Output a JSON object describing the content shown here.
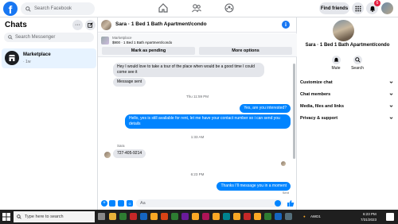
{
  "topbar": {
    "search_placeholder": "Search Facebook",
    "find_friends": "Find friends",
    "notification_count": "6"
  },
  "chats": {
    "title": "Chats",
    "search_placeholder": "Search Messenger",
    "items": [
      {
        "name": "Marketplace",
        "sub": "· 1w"
      }
    ]
  },
  "conversation": {
    "title": "Sara · 1 Bed 1 Bath Apartment/condo",
    "listing": {
      "label": "Marketplace",
      "price": "$900 · 1 Bed 1 Bath Apartment/condo",
      "mark_pending": "Mark as pending",
      "more_options": "More options"
    },
    "messages": [
      {
        "type": "in",
        "text": "Hey I would love to take a tour of the place when would be a good time I could come see it"
      },
      {
        "type": "in",
        "text": "Message sent"
      },
      {
        "type": "time",
        "text": "Thu 11:59 PM"
      },
      {
        "type": "out",
        "text": "Yes, are you interested?"
      },
      {
        "type": "out",
        "text": "Hello, yes is still available for rent, let me have your contact number so i can send you details"
      },
      {
        "type": "time",
        "text": "1:33 AM"
      },
      {
        "type": "sender",
        "text": "Sara"
      },
      {
        "type": "in",
        "text": "727-405-9214"
      },
      {
        "type": "time",
        "text": "6:23 PM"
      },
      {
        "type": "out",
        "text": "Thanks I’ll message you in a moment"
      },
      {
        "type": "status",
        "text": "Sent"
      }
    ],
    "composer_placeholder": "Aa"
  },
  "info_panel": {
    "name": "Sara · 1 Bed 1 Bath Apartment/condo",
    "actions": [
      {
        "label": "Mute"
      },
      {
        "label": "Search"
      }
    ],
    "sections": [
      {
        "label": "Customize chat"
      },
      {
        "label": "Chat members"
      },
      {
        "label": "Media, files and links"
      },
      {
        "label": "Privacy & support"
      }
    ]
  },
  "taskbar": {
    "search_placeholder": "Type here to search",
    "weather": "AWD1",
    "time": "6:23 PM",
    "date": "7/31/2023"
  },
  "colors": {
    "accent": "#1877f2",
    "outgoing": "#0084ff",
    "incoming": "#e4e6eb"
  }
}
